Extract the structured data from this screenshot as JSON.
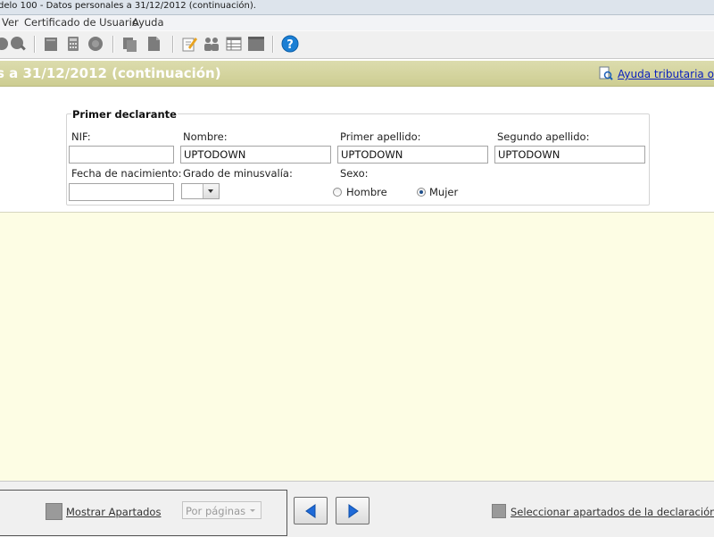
{
  "window": {
    "title": "delo 100 - Datos personales a 31/12/2012 (continuación)."
  },
  "menu": {
    "items": [
      "Ver",
      "Certificado de Usuario",
      "Ayuda"
    ]
  },
  "toolbar": {
    "icons": [
      "search-icon",
      "document-icon",
      "calculator-icon",
      "record-icon",
      "copy-icon",
      "export-icon",
      "edit-icon",
      "people-icon",
      "table-icon",
      "window-icon",
      "help-icon"
    ]
  },
  "header": {
    "title": "s a 31/12/2012 (continuación)",
    "help_link": "Ayuda tributaria onlin"
  },
  "section": {
    "legend": "Primer declarante",
    "labels": {
      "nif": "NIF:",
      "nombre": "Nombre:",
      "primer_apellido": "Primer apellido:",
      "segundo_apellido": "Segundo apellido:",
      "fecha": "Fecha de nacimiento:",
      "grado": "Grado de minusvalía:",
      "sexo": "Sexo:"
    },
    "values": {
      "nif": "",
      "nombre": "UPTODOWN",
      "primer_apellido": "UPTODOWN",
      "segundo_apellido": "UPTODOWN",
      "fecha": "",
      "grado": ""
    },
    "sexo_options": [
      "Hombre",
      "Mujer"
    ],
    "sexo_selected": "Mujer"
  },
  "footer": {
    "show_link": "Mostrar Apartados",
    "pages_select": "Por páginas",
    "select_link": "Seleccionar apartados de la declaración"
  },
  "colors": {
    "header_band": "#cdcd92",
    "workarea": "#fdfde4",
    "link": "#0a1fbf",
    "nav_arrow": "#1e6ad8"
  }
}
